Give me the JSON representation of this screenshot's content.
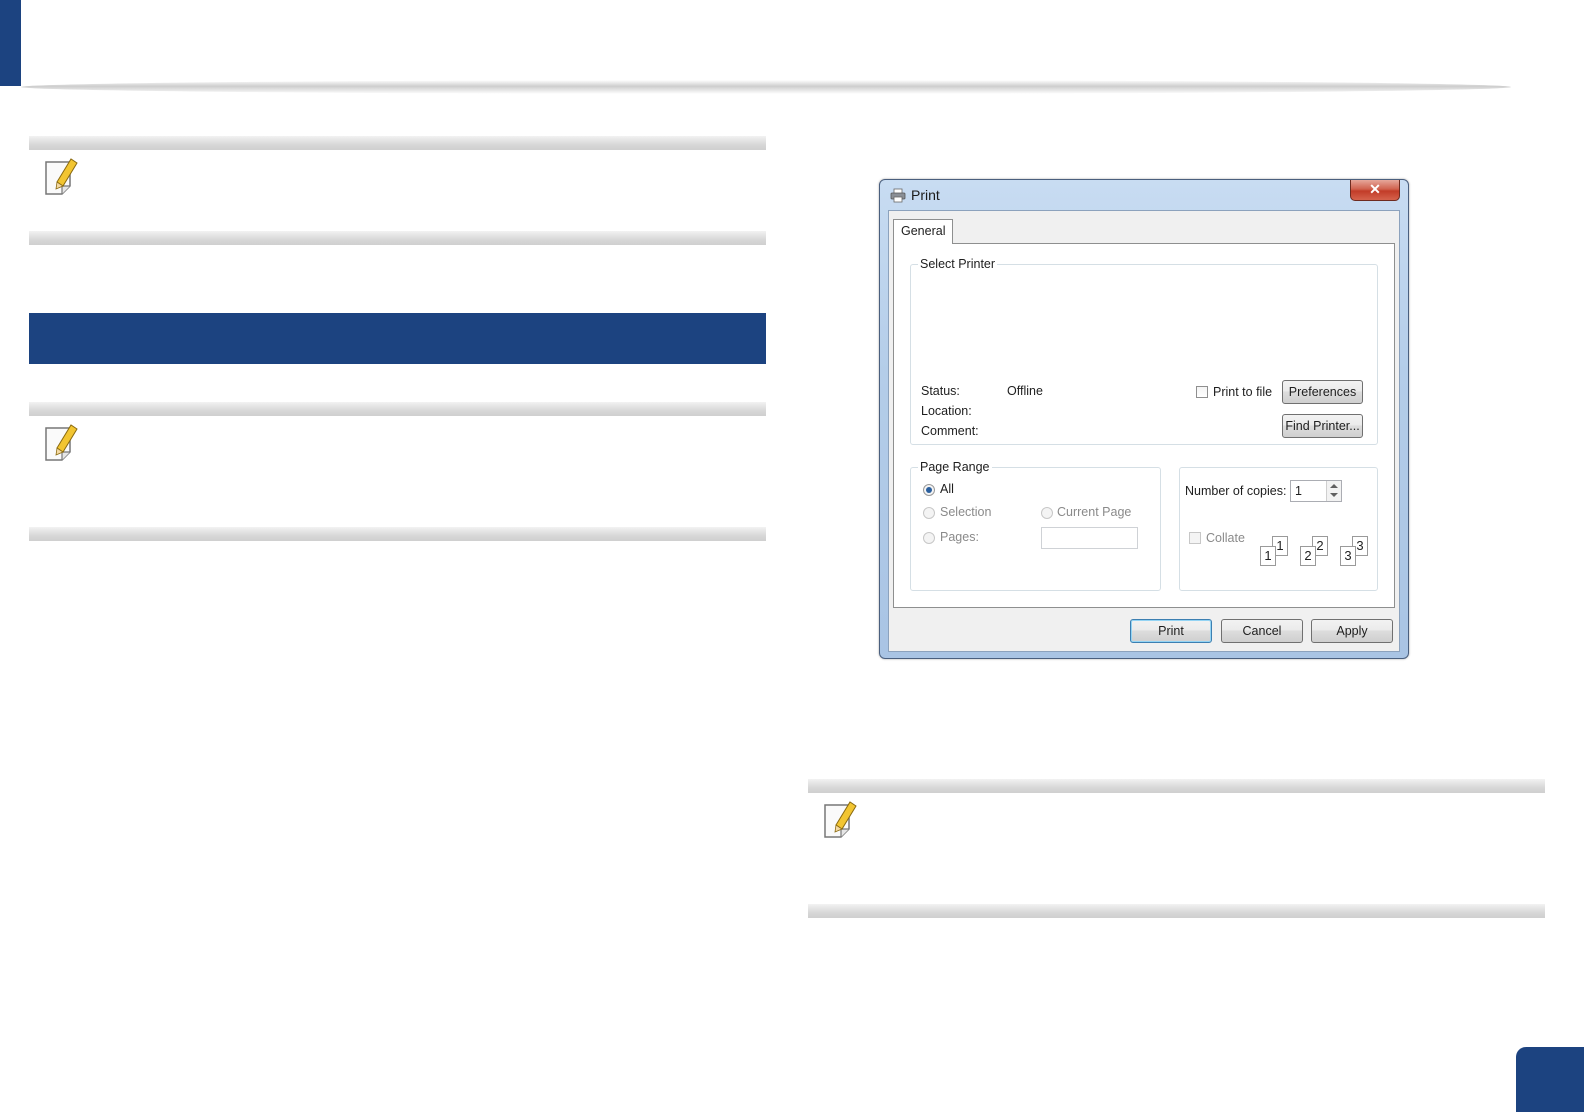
{
  "dialog": {
    "title": "Print",
    "close_glyph": "✕",
    "tab_general": "General",
    "select_printer": {
      "label": "Select Printer",
      "status_label": "Status:",
      "status_value": "Offline",
      "location_label": "Location:",
      "comment_label": "Comment:",
      "print_to_file_label": "Print to file",
      "preferences_button": "Preferences",
      "find_printer_button": "Find Printer..."
    },
    "page_range": {
      "label": "Page Range",
      "all": "All",
      "selection": "Selection",
      "current_page": "Current Page",
      "pages": "Pages:"
    },
    "copies": {
      "label": "Number of copies:",
      "value": "1",
      "collate_label": "Collate",
      "collate_pages": [
        "1",
        "1",
        "2",
        "2",
        "3",
        "3"
      ]
    },
    "buttons": {
      "print": "Print",
      "cancel": "Cancel",
      "apply": "Apply"
    }
  },
  "icons": {
    "note": "note-pencil-icon",
    "printer": "printer-icon"
  },
  "colors": {
    "accent_blue": "#1c4380"
  }
}
